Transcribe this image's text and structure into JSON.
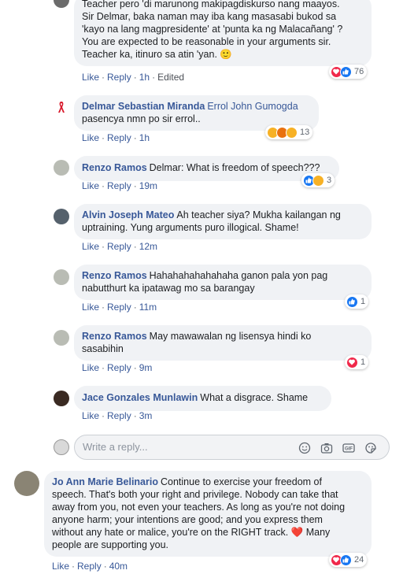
{
  "comments": [
    {
      "author": "",
      "tag": "",
      "text_lines": [
        "Teacher pero 'di marunong makipagdiskurso nang maayos.",
        "Sir Delmar, baka naman may iba kang masasabi bukod sa",
        "'kayo na lang magpresidente' at 'punta ka ng Malacañang' ?",
        "You are expected to be reasonable in your arguments sir.",
        "Teacher ka, itinuro sa atin 'yan. 🙂"
      ],
      "like": "Like",
      "reply": "Reply",
      "time": "1h",
      "edited": "Edited",
      "reactions": [
        "love",
        "like"
      ],
      "count": "76"
    },
    {
      "author": "Delmar Sebastian Miranda",
      "tag": "Errol John Gumogda",
      "text_lines": [
        "pasencya nmn po sir errol.."
      ],
      "like": "Like",
      "reply": "Reply",
      "time": "1h",
      "reactions": [
        "haha",
        "angry",
        "wow"
      ],
      "count": "13"
    },
    {
      "author": "Renzo Ramos",
      "text_lines": [
        "Delmar: What is freedom of speech???"
      ],
      "like": "Like",
      "reply": "Reply",
      "time": "19m",
      "reactions": [
        "like",
        "haha"
      ],
      "count": "3"
    },
    {
      "author": "Alvin Joseph Mateo",
      "text_lines": [
        "Ah teacher siya? Mukha kailangan ng",
        "uptraining. Yung arguments puro illogical. Shame!"
      ],
      "like": "Like",
      "reply": "Reply",
      "time": "12m"
    },
    {
      "author": "Renzo Ramos",
      "text_lines": [
        "Hahahahahahahaha ganon pala yon pag",
        "nabutthurt ka ipatawag mo sa barangay"
      ],
      "like": "Like",
      "reply": "Reply",
      "time": "11m",
      "reactions": [
        "like"
      ],
      "count": "1"
    },
    {
      "author": "Renzo Ramos",
      "text_lines": [
        "May mawawalan ng lisensya hindi ko",
        "sasabihin"
      ],
      "like": "Like",
      "reply": "Reply",
      "time": "9m",
      "reactions": [
        "love"
      ],
      "count": "1"
    },
    {
      "author": "Jace Gonzales Munlawin",
      "text_lines": [
        "What a disgrace. Shame"
      ],
      "like": "Like",
      "reply": "Reply",
      "time": "3m"
    },
    {
      "author": "Jo Ann Marie Belinario",
      "text_lines": [
        "Continue to exercise your freedom of",
        "speech. That's both your right and privilege. Nobody can take that",
        "away from you, not even your teachers. As long as you're not doing",
        "anyone harm; your intentions are good; and you express them",
        "without any hate or malice, you're on the RIGHT track. ❤️ Many",
        "people are supporting you."
      ],
      "like": "Like",
      "reply": "Reply",
      "time": "40m",
      "reactions": [
        "love",
        "like"
      ],
      "count": "24"
    }
  ],
  "reply_box": {
    "placeholder": "Write a reply..."
  },
  "colors": {
    "link": "#385898",
    "bubble": "#f0f2f5",
    "like": "#1877f2",
    "love": "#f0284a"
  },
  "icons": [
    "emoji-icon",
    "camera-icon",
    "gif-icon",
    "sticker-icon"
  ]
}
